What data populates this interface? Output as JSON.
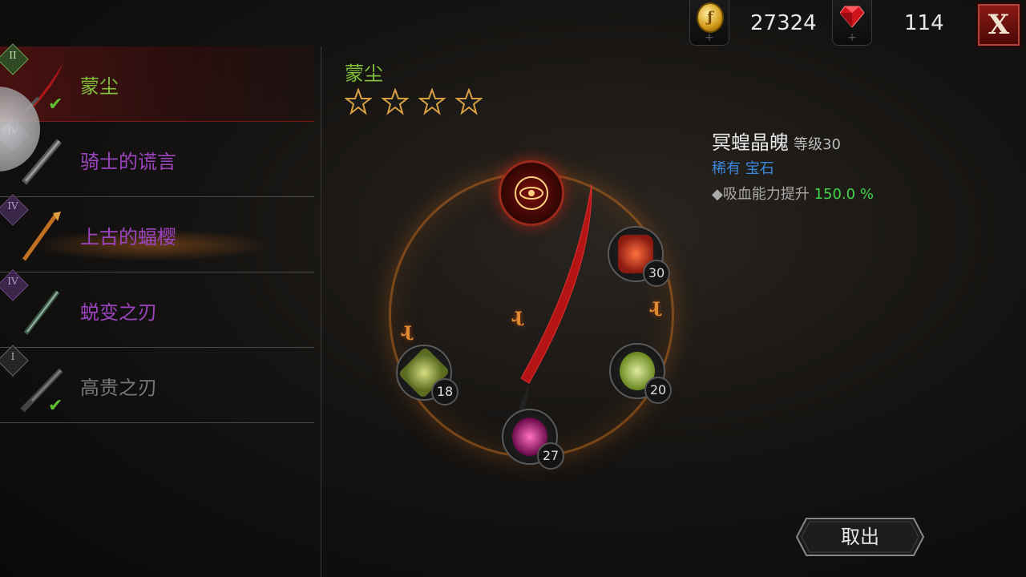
{
  "currency": {
    "coin_icon_text": "ƒ",
    "coin_value": "27324",
    "gem_value": "114",
    "add_symbol": "+"
  },
  "close_label": "X",
  "weapons": [
    {
      "tier": "II",
      "name": "蒙尘",
      "equipped": true
    },
    {
      "tier": "IV",
      "name": "骑士的谎言",
      "equipped": false
    },
    {
      "tier": "IV",
      "name": "上古的蝠樱",
      "equipped": false
    },
    {
      "tier": "IV",
      "name": "蜕变之刃",
      "equipped": false
    },
    {
      "tier": "I",
      "name": "高贵之刃",
      "equipped": true
    }
  ],
  "check_mark": "✔",
  "selected": {
    "name": "蒙尘",
    "stars": 4
  },
  "runes": [
    "ɻ",
    "ɻ",
    "ɻ"
  ],
  "sockets": {
    "top_right": "30",
    "left": "18",
    "right": "20",
    "bottom": "27"
  },
  "gem_info": {
    "name": "冥蝗晶魄",
    "level": "等级30",
    "rarity": "稀有 宝石",
    "stat_label": "◆吸血能力提升",
    "stat_value": "150.0 %"
  },
  "take_out_label": "取出",
  "colors": {
    "accent_green": "#7fbf3a",
    "rarity_purple": "#9c44c0",
    "stat_green": "#3fd44a",
    "rare_blue": "#3a8ae0"
  }
}
